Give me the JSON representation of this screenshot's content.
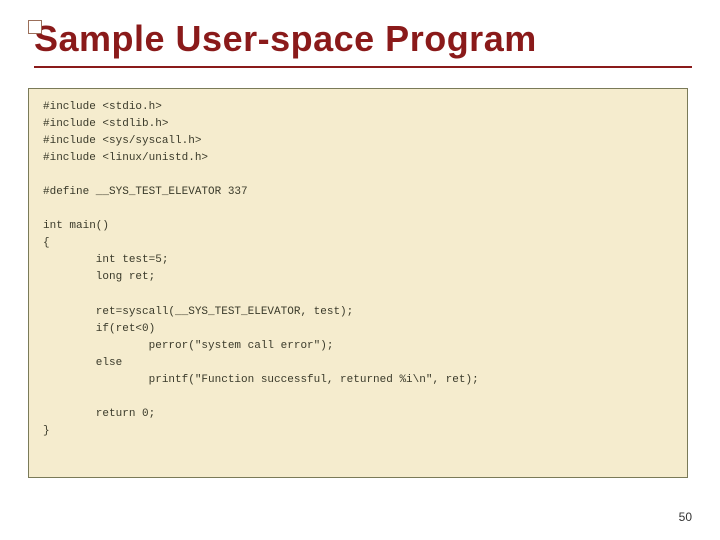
{
  "title": "Sample User-space Program",
  "code": "#include <stdio.h>\n#include <stdlib.h>\n#include <sys/syscall.h>\n#include <linux/unistd.h>\n\n#define __SYS_TEST_ELEVATOR 337\n\nint main()\n{\n        int test=5;\n        long ret;\n\n        ret=syscall(__SYS_TEST_ELEVATOR, test);\n        if(ret<0)\n                perror(\"system call error\");\n        else\n                printf(\"Function successful, returned %i\\n\", ret);\n\n        return 0;\n}",
  "page_number": "50"
}
